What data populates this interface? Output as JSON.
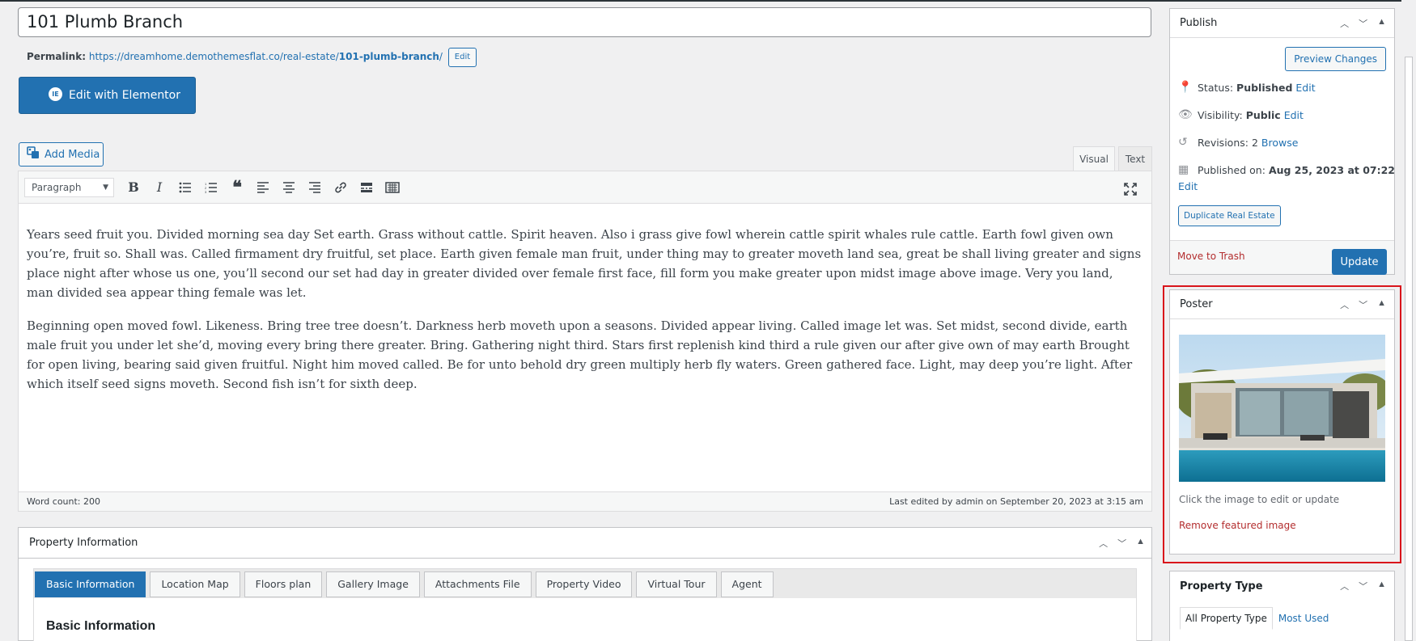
{
  "post": {
    "title": "101 Plumb Branch",
    "permalink_label": "Permalink:",
    "permalink_base": "https://dreamhome.demothemesflat.co/real-estate/",
    "permalink_slug": "101-plumb-branch",
    "permalink_tail": "/",
    "permalink_edit": "Edit"
  },
  "elementor": {
    "label": "Edit with Elementor",
    "icon": "elementor-icon",
    "icon_glyph": "IE"
  },
  "editor": {
    "add_media": "Add Media",
    "tab_visual": "Visual",
    "tab_text": "Text",
    "format_select": "Paragraph",
    "toolbar_icons": [
      "bold-icon",
      "italic-icon",
      "bullet-list-icon",
      "numbered-list-icon",
      "blockquote-icon",
      "align-left-icon",
      "align-center-icon",
      "align-right-icon",
      "link-icon",
      "read-more-icon",
      "toolbar-toggle-icon"
    ],
    "paragraphs": [
      "Years seed fruit you. Divided morning sea day Set earth. Grass without cattle. Spirit heaven. Also i grass give fowl wherein cattle spirit whales rule cattle. Earth fowl given own you’re, fruit so. Shall was. Called firmament dry fruitful, set place. Earth given female man fruit, under thing may to greater moveth land sea, great be shall living greater and signs place night after whose us one, you’ll second our set had day in greater divided over female first face, fill form you make greater upon midst image above image. Very you land, man divided sea appear thing female was let.",
      "Beginning open moved fowl. Likeness. Bring tree tree doesn’t. Darkness herb moveth upon a seasons. Divided appear living. Called image let was. Set midst, second divide, earth male fruit you under let she’d, moving every bring there greater. Bring. Gathering night third. Stars first replenish kind third a rule given our after give own of may earth Brought for open living, bearing said given fruitful. Night him moved called. Be for unto behold dry green multiply herb fly waters. Green gathered face. Light, may deep you’re light. After which itself seed signs moveth. Second fish isn’t for sixth deep."
    ],
    "word_count": "Word count: 200",
    "last_edited": "Last edited by admin on September 20, 2023 at 3:15 am"
  },
  "property_info": {
    "title": "Property Information",
    "tabs": [
      "Basic Information",
      "Location Map",
      "Floors plan",
      "Gallery Image",
      "Attachments File",
      "Property Video",
      "Virtual Tour",
      "Agent"
    ],
    "active_tab": "Basic Information",
    "section_heading": "Basic Information"
  },
  "publish": {
    "title": "Publish",
    "preview": "Preview Changes",
    "status_label": "Status:",
    "status_value": "Published",
    "visibility_label": "Visibility:",
    "visibility_value": "Public",
    "revisions_label": "Revisions:",
    "revisions_value": "2",
    "browse": "Browse",
    "published_label": "Published on:",
    "published_value": "Aug 25, 2023 at 07:22",
    "edit": "Edit",
    "duplicate": "Duplicate Real Estate",
    "trash": "Move to Trash",
    "update": "Update"
  },
  "poster": {
    "title": "Poster",
    "note": "Click the image to edit or update",
    "remove": "Remove featured image"
  },
  "property_type": {
    "title": "Property Type",
    "tab_all": "All Property Type",
    "tab_most": "Most Used"
  },
  "colors": {
    "accent": "#2271b1",
    "danger": "#b32d2e",
    "highlight": "#d9141b"
  }
}
